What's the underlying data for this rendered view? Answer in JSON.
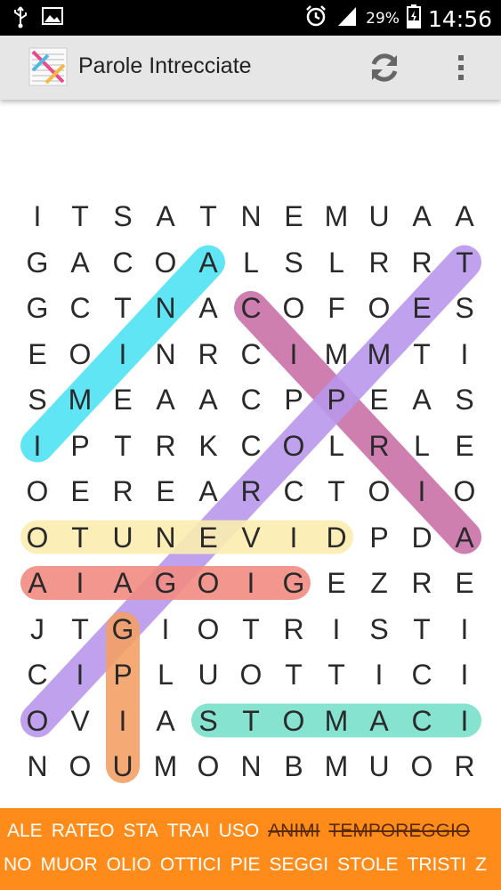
{
  "status_bar": {
    "battery_percent": "29%",
    "time": "14:56"
  },
  "app_bar": {
    "title": "Parole Intrecciate"
  },
  "grid": [
    "ITSATNEMUAA",
    "GACOALSLRRT",
    "GCTNACOFOES",
    "EOINRCIMMTI",
    "SMEAACPPEAS",
    "IPTRKCOLRLE",
    "OEREARCTOIO",
    "OTUNEVIDPDA",
    "AIAGOIGEZRE",
    "JTGIOTRISTI",
    "CIPLUOTTICI",
    "OVIASTOMACI",
    "NOUMONBMUOR"
  ],
  "found_words": [
    {
      "color": "#4fe3f5",
      "from": [
        5,
        0
      ],
      "to": [
        1,
        4
      ]
    },
    {
      "color": "#c972a8",
      "from": [
        2,
        5
      ],
      "to": [
        7,
        10
      ]
    },
    {
      "color": "#b997ec",
      "from": [
        11,
        0
      ],
      "to": [
        1,
        10
      ]
    },
    {
      "color": "#fbeeb0",
      "from": [
        7,
        0
      ],
      "to": [
        7,
        7
      ]
    },
    {
      "color": "#f28b82",
      "from": [
        8,
        0
      ],
      "to": [
        8,
        6
      ]
    },
    {
      "color": "#f5a065",
      "from": [
        9,
        2
      ],
      "to": [
        12,
        2
      ]
    },
    {
      "color": "#79e0cc",
      "from": [
        11,
        4
      ],
      "to": [
        11,
        10
      ]
    }
  ],
  "word_list": {
    "row1": [
      {
        "text": "ALE",
        "found": false
      },
      {
        "text": "RATEO",
        "found": false
      },
      {
        "text": "STA",
        "found": false
      },
      {
        "text": "TRAI",
        "found": false
      },
      {
        "text": "USO",
        "found": false
      },
      {
        "text": "ANIMI",
        "found": true
      },
      {
        "text": "TEMPOREGGIO",
        "found": true
      }
    ],
    "row2": [
      {
        "text": "NO",
        "found": false
      },
      {
        "text": "MUOR",
        "found": false
      },
      {
        "text": "OLIO",
        "found": false
      },
      {
        "text": "OTTICI",
        "found": false
      },
      {
        "text": "PIE",
        "found": false
      },
      {
        "text": "SEGGI",
        "found": false
      },
      {
        "text": "STOLE",
        "found": false
      },
      {
        "text": "TRISTI",
        "found": false
      },
      {
        "text": "Z",
        "found": false
      }
    ]
  },
  "icons": {
    "status_left": [
      "usb-icon",
      "image-icon"
    ],
    "status_right": [
      "alarm-icon",
      "signal-icon",
      "battery-icon"
    ],
    "app_bar": [
      "app-logo-icon",
      "refresh-icon",
      "overflow-menu-icon"
    ]
  },
  "colors": {
    "word_bar": "#ff8c1a",
    "app_bar": "#e6e6e6"
  }
}
